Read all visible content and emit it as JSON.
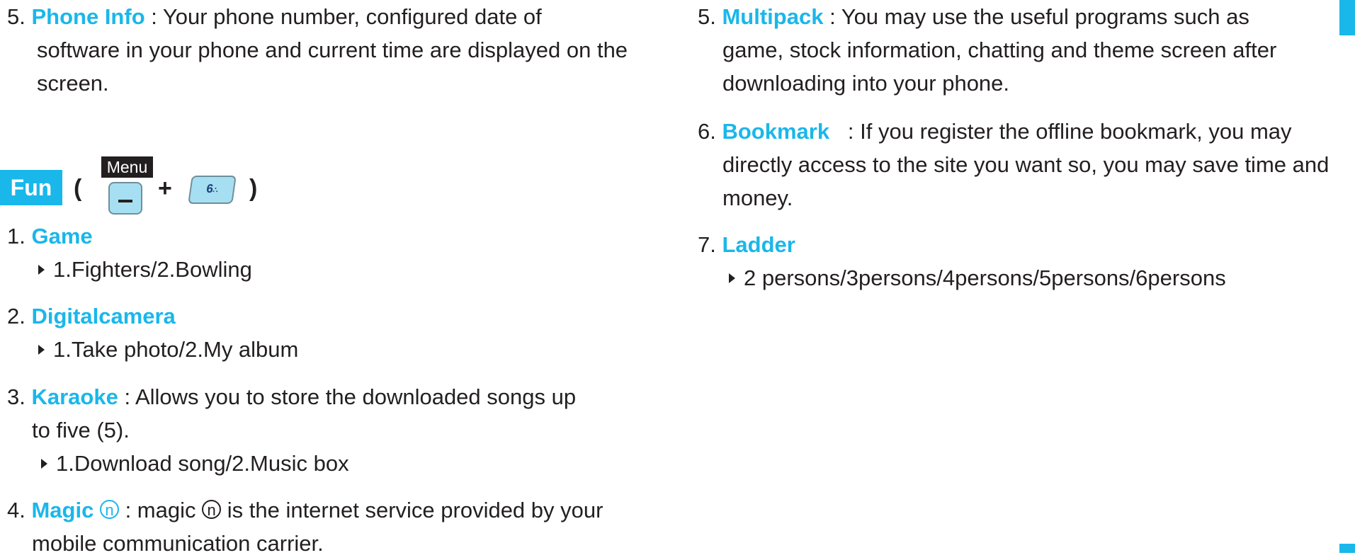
{
  "left": {
    "phone_info": {
      "num": "5.",
      "term": "Phone Info",
      "sep": " : Your phone number, configured date of",
      "cont": [
        "software in your phone and current time are displayed on the",
        "screen."
      ]
    },
    "fun": {
      "title": "Fun",
      "open_paren": "(",
      "close_paren": ")",
      "menu_label": "Menu",
      "plus": "+",
      "key_icon": "six-key-icon",
      "key_text": "6"
    },
    "items": [
      {
        "num": "1.",
        "term": "Game",
        "sub": "1.Fighters/2.Bowling"
      },
      {
        "num": "2.",
        "term": "Digitalcamera",
        "sub": "1.Take photo/2.My album"
      },
      {
        "num": "3.",
        "term": "Karaoke",
        "desc": " : Allows you to store the downloaded songs up",
        "cont": "to five (5).",
        "sub": "1.Download song/2.Music box"
      },
      {
        "num": "4.",
        "term": "Magic",
        "circle": "n",
        "desc_a": " :  magic ",
        "circle2": "n",
        "desc_b": " is the internet service provided by your",
        "cont": "mobile communication carrier."
      }
    ]
  },
  "right": {
    "items": [
      {
        "num": "5.",
        "term": "Multipack",
        "desc": " : You may use the useful programs such as",
        "cont": [
          "game, stock information, chatting and theme screen after",
          "downloading into your phone."
        ]
      },
      {
        "num": "6.",
        "term": "Bookmark",
        "desc": "   : If you register the offline bookmark, you may",
        "cont": [
          "directly access to the site you want so, you may save time and",
          "money."
        ]
      },
      {
        "num": "7.",
        "term": "Ladder",
        "sub": "2 persons/3persons/4persons/5persons/6persons"
      }
    ]
  },
  "colors": {
    "accent": "#1ab7ea",
    "text": "#231f20"
  }
}
